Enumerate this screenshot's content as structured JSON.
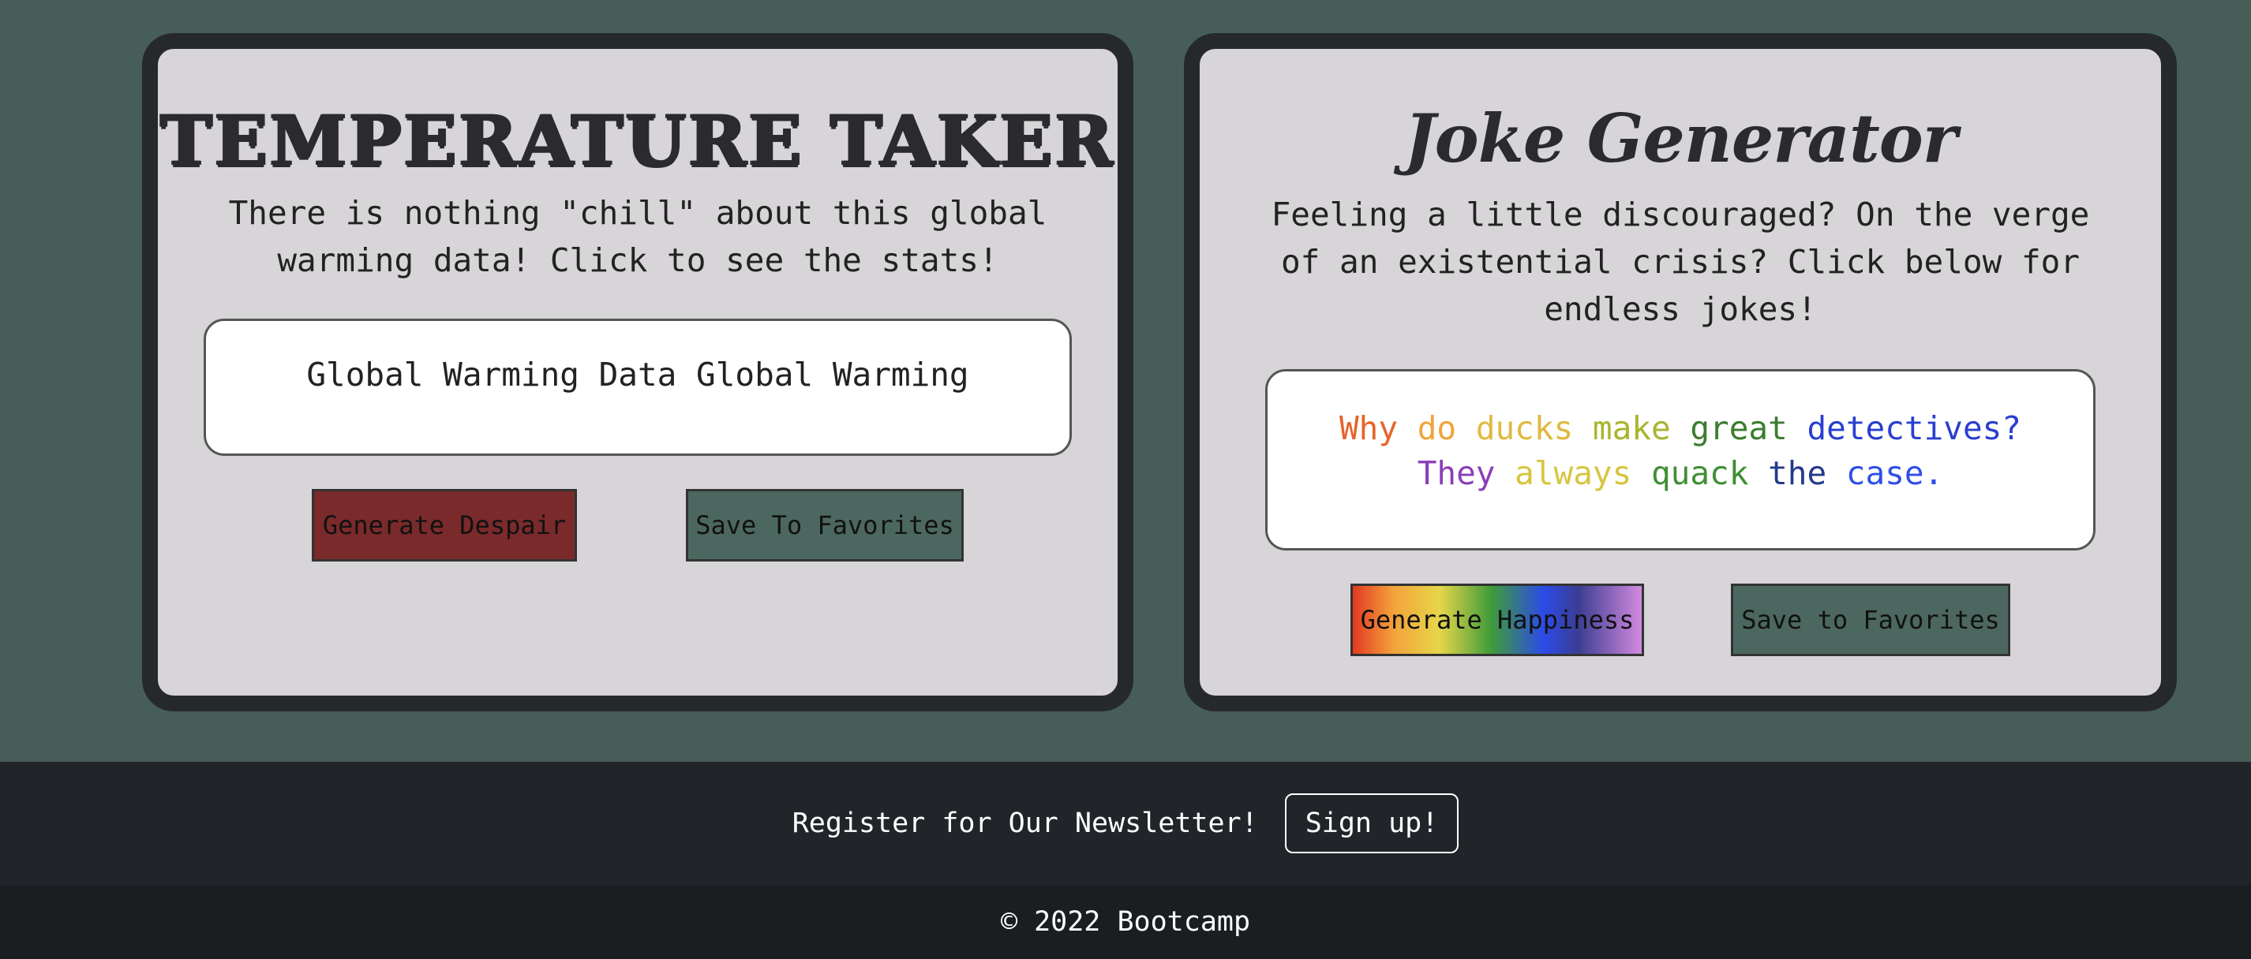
{
  "temperature": {
    "title": "TEMPERATURE TAKER",
    "description": "There is nothing \"chill\" about this global warming data! Click to see the stats!",
    "output": "Global Warming Data Global Warming",
    "generate_label": "Generate Despair",
    "save_label": "Save To Favorites"
  },
  "joke": {
    "title": "Joke Generator",
    "description": "Feeling a little discouraged? On the verge of an existential crisis? Click below for endless jokes!",
    "words": [
      {
        "text": "Why",
        "color": "#e8632b"
      },
      {
        "text": "do",
        "color": "#f0a43a"
      },
      {
        "text": "ducks",
        "color": "#e0b93f"
      },
      {
        "text": "make",
        "color": "#a9b52f"
      },
      {
        "text": "great",
        "color": "#3a7d2f"
      },
      {
        "text": "detectives?",
        "color": "#2a3fd0"
      },
      {
        "text": "They",
        "color": "#8a3fb6"
      },
      {
        "text": "always",
        "color": "#d6c640"
      },
      {
        "text": "quack",
        "color": "#3f8f34"
      },
      {
        "text": "the",
        "color": "#243a8a"
      },
      {
        "text": "case.",
        "color": "#2f4fe8"
      }
    ],
    "generate_label": "Generate Happiness",
    "save_label": "Save to Favorites"
  },
  "newsletter": {
    "text": "Register for Our Newsletter!",
    "button_label": "Sign up!"
  },
  "footer": {
    "text": "© 2022 Bootcamp"
  },
  "colors": {
    "background": "#465e57",
    "card": "#d7d5d7",
    "card_border": "#26292c",
    "despair_button": "#7a2a2a",
    "favorites_button": "#4c675f",
    "newsletter_bg": "#212529",
    "footer_bg": "#1b1e21"
  }
}
